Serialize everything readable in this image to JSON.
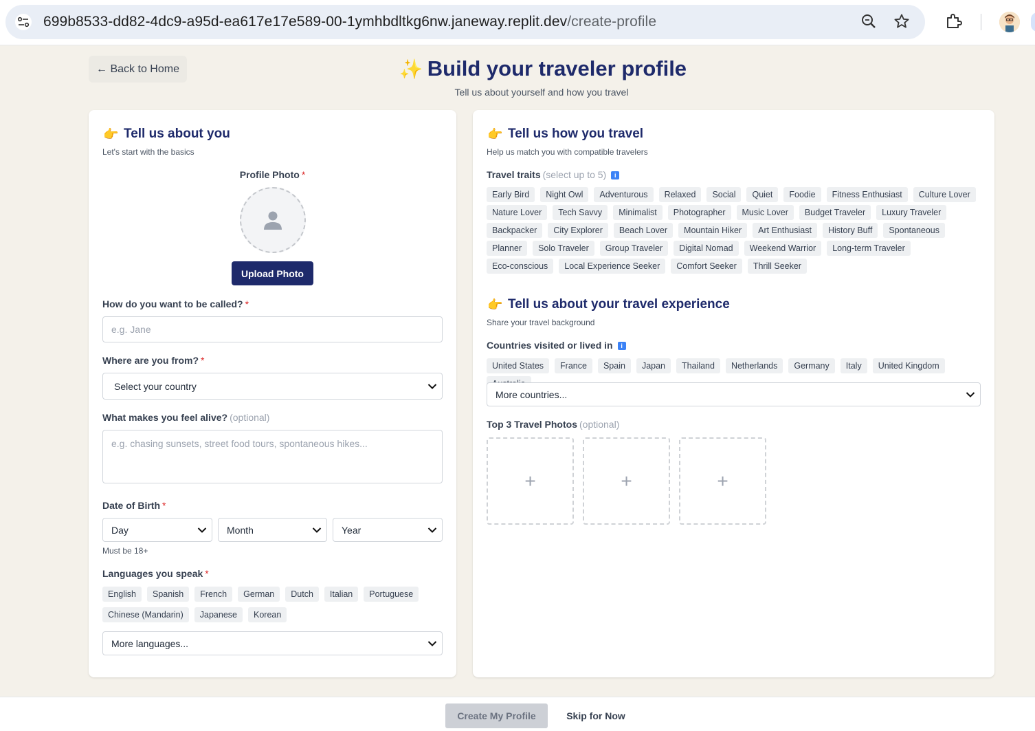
{
  "browser": {
    "url_host": "699b8533-dd82-4dc9-a95d-ea617e17e589-00-1ymhbdltkg6nw.janeway.replit.dev",
    "url_path": "/create-profile",
    "icons": [
      "site-settings-icon",
      "zoom-icon",
      "bookmark-star-icon",
      "extensions-icon",
      "profile-avatar"
    ]
  },
  "header": {
    "back_label": "← Back to Home",
    "title_emoji": "✨",
    "title": "Build your traveler profile",
    "subtitle": "Tell us about yourself and how you travel"
  },
  "about": {
    "emoji": "👉",
    "title": "Tell us about you",
    "subtitle": "Let's start with the basics",
    "photo_label": "Profile Photo",
    "required_mark": "*",
    "upload_label": "Upload Photo",
    "name_label": "How do you want to be called?",
    "name_placeholder": "e.g. Jane",
    "from_label": "Where are you from?",
    "country_value": "Select your country",
    "alive_label": "What makes you feel alive?",
    "optional_text": "(optional)",
    "alive_placeholder": "e.g. chasing sunsets, street food tours, spontaneous hikes...",
    "dob_label": "Date of Birth",
    "dob_day": "Day",
    "dob_month": "Month",
    "dob_year": "Year",
    "dob_hint": "Must be 18+",
    "languages_label": "Languages you speak",
    "languages_row1": [
      "English",
      "Spanish",
      "French",
      "German",
      "Dutch",
      "Italian",
      "Portuguese"
    ],
    "languages_row2": [
      "Chinese (Mandarin)",
      "Japanese",
      "Korean"
    ],
    "more_languages": "More languages..."
  },
  "travel": {
    "emoji": "👉",
    "title": "Tell us how you travel",
    "subtitle": "Help us match you with compatible travelers",
    "traits_label": "Travel traits",
    "traits_note": "(select up to 5)",
    "traits": [
      "Early Bird",
      "Night Owl",
      "Adventurous",
      "Relaxed",
      "Social",
      "Quiet",
      "Foodie",
      "Fitness Enthusiast",
      "Culture Lover",
      "Nature Lover",
      "Tech Savvy",
      "Minimalist",
      "Photographer",
      "Music Lover",
      "Budget Traveler",
      "Luxury Traveler",
      "Backpacker",
      "City Explorer",
      "Beach Lover",
      "Mountain Hiker",
      "Art Enthusiast",
      "History Buff",
      "Spontaneous",
      "Planner",
      "Solo Traveler",
      "Group Traveler",
      "Digital Nomad",
      "Weekend Warrior",
      "Long-term Traveler",
      "Eco-conscious",
      "Local Experience Seeker",
      "Comfort Seeker",
      "Thrill Seeker"
    ]
  },
  "experience": {
    "emoji": "👉",
    "title": "Tell us about your travel experience",
    "subtitle": "Share your travel background",
    "countries_label": "Countries visited or lived in",
    "countries": [
      "United States",
      "France",
      "Spain",
      "Japan",
      "Thailand",
      "Netherlands",
      "Germany",
      "Italy",
      "United Kingdom",
      "Australia"
    ],
    "more_countries": "More countries...",
    "photos_label": "Top 3 Travel Photos",
    "photos_optional": "(optional)",
    "slot_symbol": "+"
  },
  "footer": {
    "create_label": "Create My Profile",
    "skip_label": "Skip for Now"
  },
  "colors": {
    "brand": "#1e2a6b",
    "background": "#f4f1ea",
    "required": "#dc2626",
    "disabled_button": "#cdd0d6"
  }
}
